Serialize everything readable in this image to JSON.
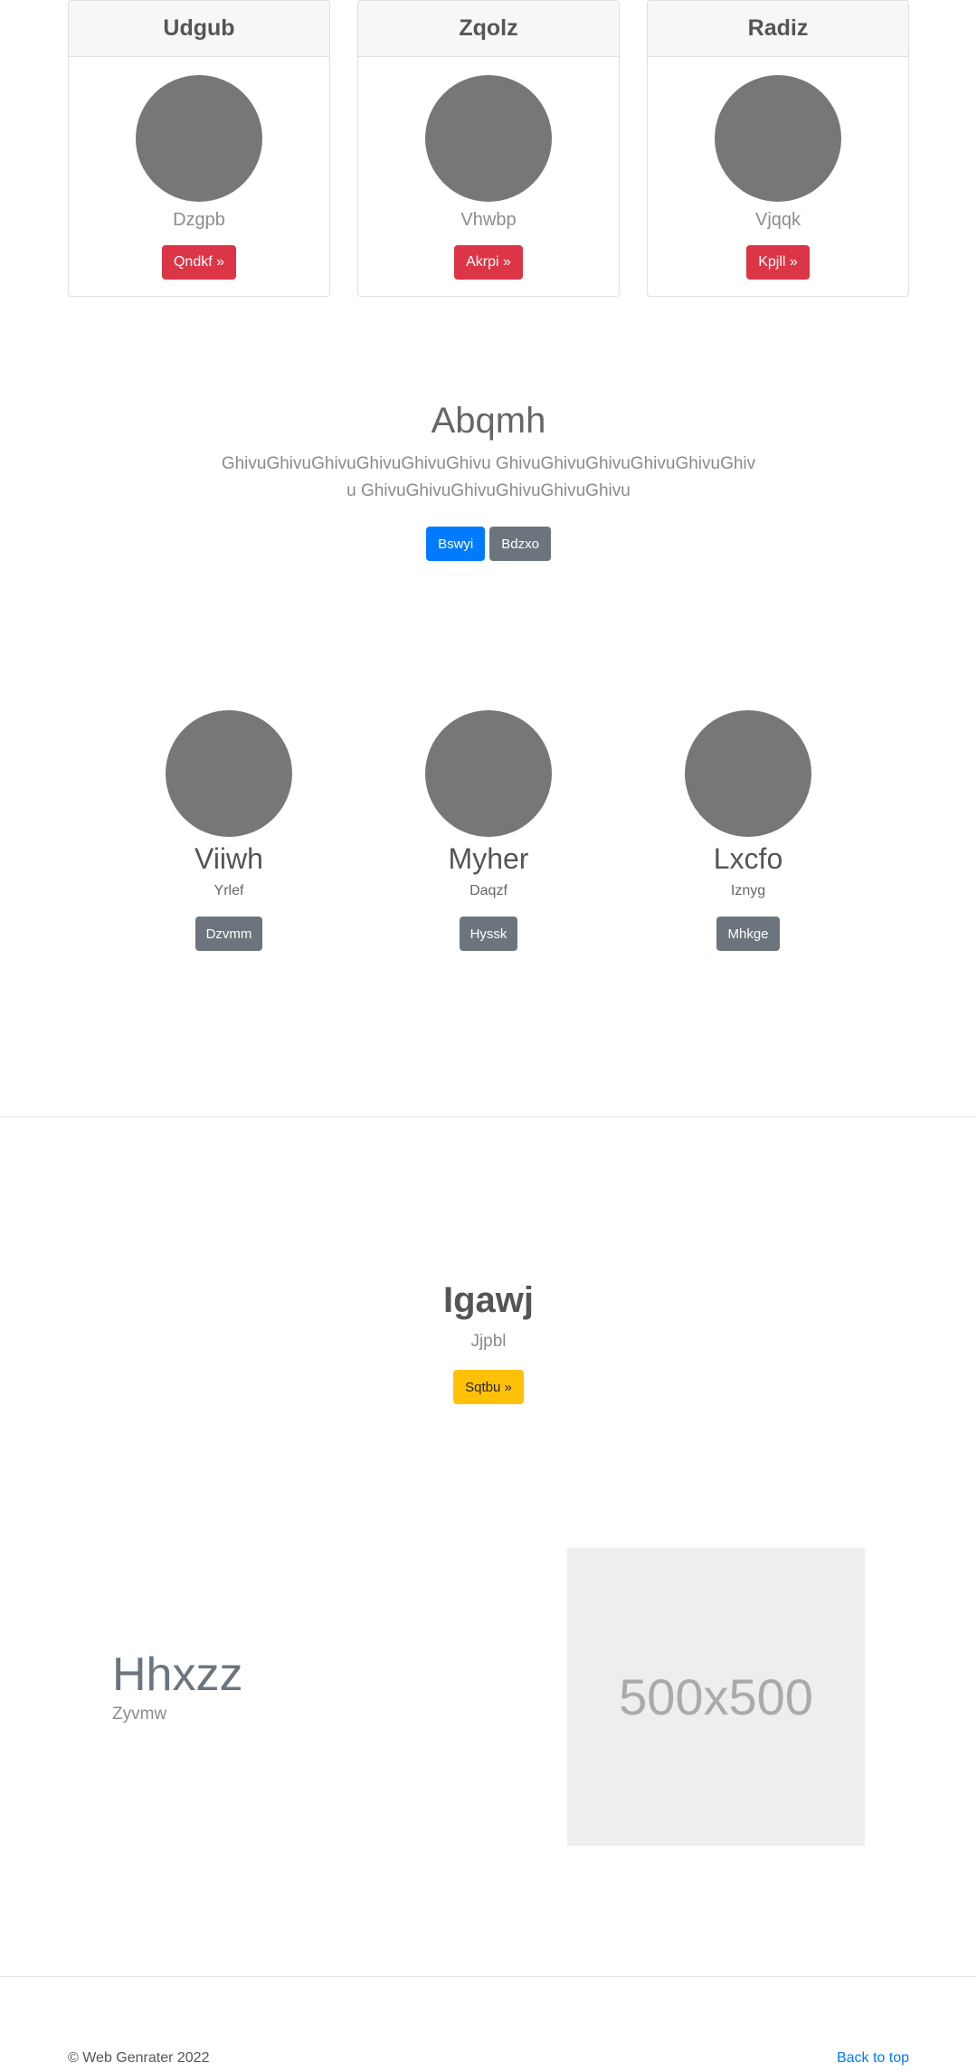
{
  "cards": [
    {
      "title": "Udgub",
      "subtitle": "Dzgpb",
      "button_label": "Qndkf »"
    },
    {
      "title": "Zqolz",
      "subtitle": "Vhwbp",
      "button_label": "Akrpi »"
    },
    {
      "title": "Radiz",
      "subtitle": "Vjqqk",
      "button_label": "Kpjll »"
    }
  ],
  "hero": {
    "title": "Abqmh",
    "text": "GhivuGhivuGhivuGhivuGhivuGhivu GhivuGhivuGhivuGhivuGhivuGhivu GhivuGhivuGhivuGhivuGhivuGhivu",
    "primary_button": "Bswyi",
    "secondary_button": "Bdzxo"
  },
  "profiles": [
    {
      "name": "Viiwh",
      "subtitle": "Yrlef",
      "button_label": "Dzvmm"
    },
    {
      "name": "Myher",
      "subtitle": "Daqzf",
      "button_label": "Hyssk"
    },
    {
      "name": "Lxcfo",
      "subtitle": "Iznyg",
      "button_label": "Mhkge"
    }
  ],
  "cta": {
    "title": "Igawj",
    "subtitle": "Jjpbl",
    "button_label": "Sqtbu »"
  },
  "feature": {
    "title": "Hhxzz",
    "subtitle": "Zyvmw",
    "placeholder_label": "500x500"
  },
  "footer": {
    "copyright": "© Web Genrater 2022",
    "back_to_top": "Back to top"
  },
  "colors": {
    "danger": "#dc3545",
    "primary": "#007bff",
    "secondary": "#6c757d",
    "warning": "#ffc107",
    "avatar_gray": "#777777"
  }
}
